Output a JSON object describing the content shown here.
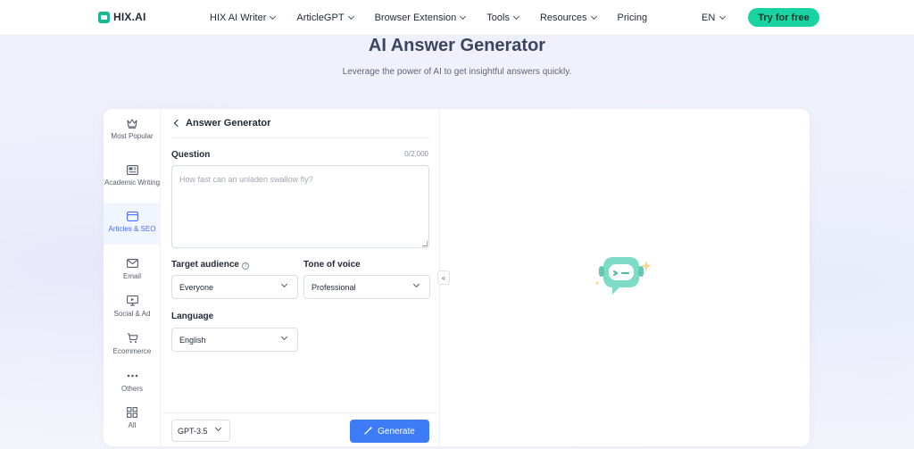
{
  "header": {
    "logo_text": "HIX.AI",
    "nav": [
      {
        "label": "HIX AI Writer"
      },
      {
        "label": "ArticleGPT"
      },
      {
        "label": "Browser Extension"
      },
      {
        "label": "Tools"
      },
      {
        "label": "Resources"
      },
      {
        "label": "Pricing"
      }
    ],
    "language": "EN",
    "cta_label": "Try for free"
  },
  "hero": {
    "title": "AI Answer Generator",
    "subtitle": "Leverage the power of AI to get insightful answers quickly."
  },
  "sidebar": {
    "items": [
      {
        "label": "Most Popular",
        "icon": "crown-icon"
      },
      {
        "label": "Academic Writing",
        "icon": "newspaper-icon"
      },
      {
        "label": "Articles & SEO",
        "icon": "browser-window-icon",
        "active": true
      },
      {
        "label": "Email",
        "icon": "envelope-icon"
      },
      {
        "label": "Social & Ad",
        "icon": "monitor-play-icon"
      },
      {
        "label": "Ecommerce",
        "icon": "cart-icon"
      },
      {
        "label": "Others",
        "icon": "more-dots-icon"
      },
      {
        "label": "All",
        "icon": "grid-icon"
      }
    ]
  },
  "panel": {
    "back_title": "Answer Generator",
    "question_label": "Question",
    "question_counter": "0/2,000",
    "question_value": "",
    "question_placeholder": "How fast can an unladen swallow fly?",
    "target_audience_label": "Target audience",
    "target_audience_value": "Everyone",
    "tone_label": "Tone of voice",
    "tone_value": "Professional",
    "language_label": "Language",
    "language_value": "English",
    "model_value": "GPT-3.5",
    "generate_label": "Generate"
  },
  "colors": {
    "accent": "#3d7bf7",
    "brand": "#19d3a2",
    "active_sidebar_bg": "#f1f5ff"
  }
}
